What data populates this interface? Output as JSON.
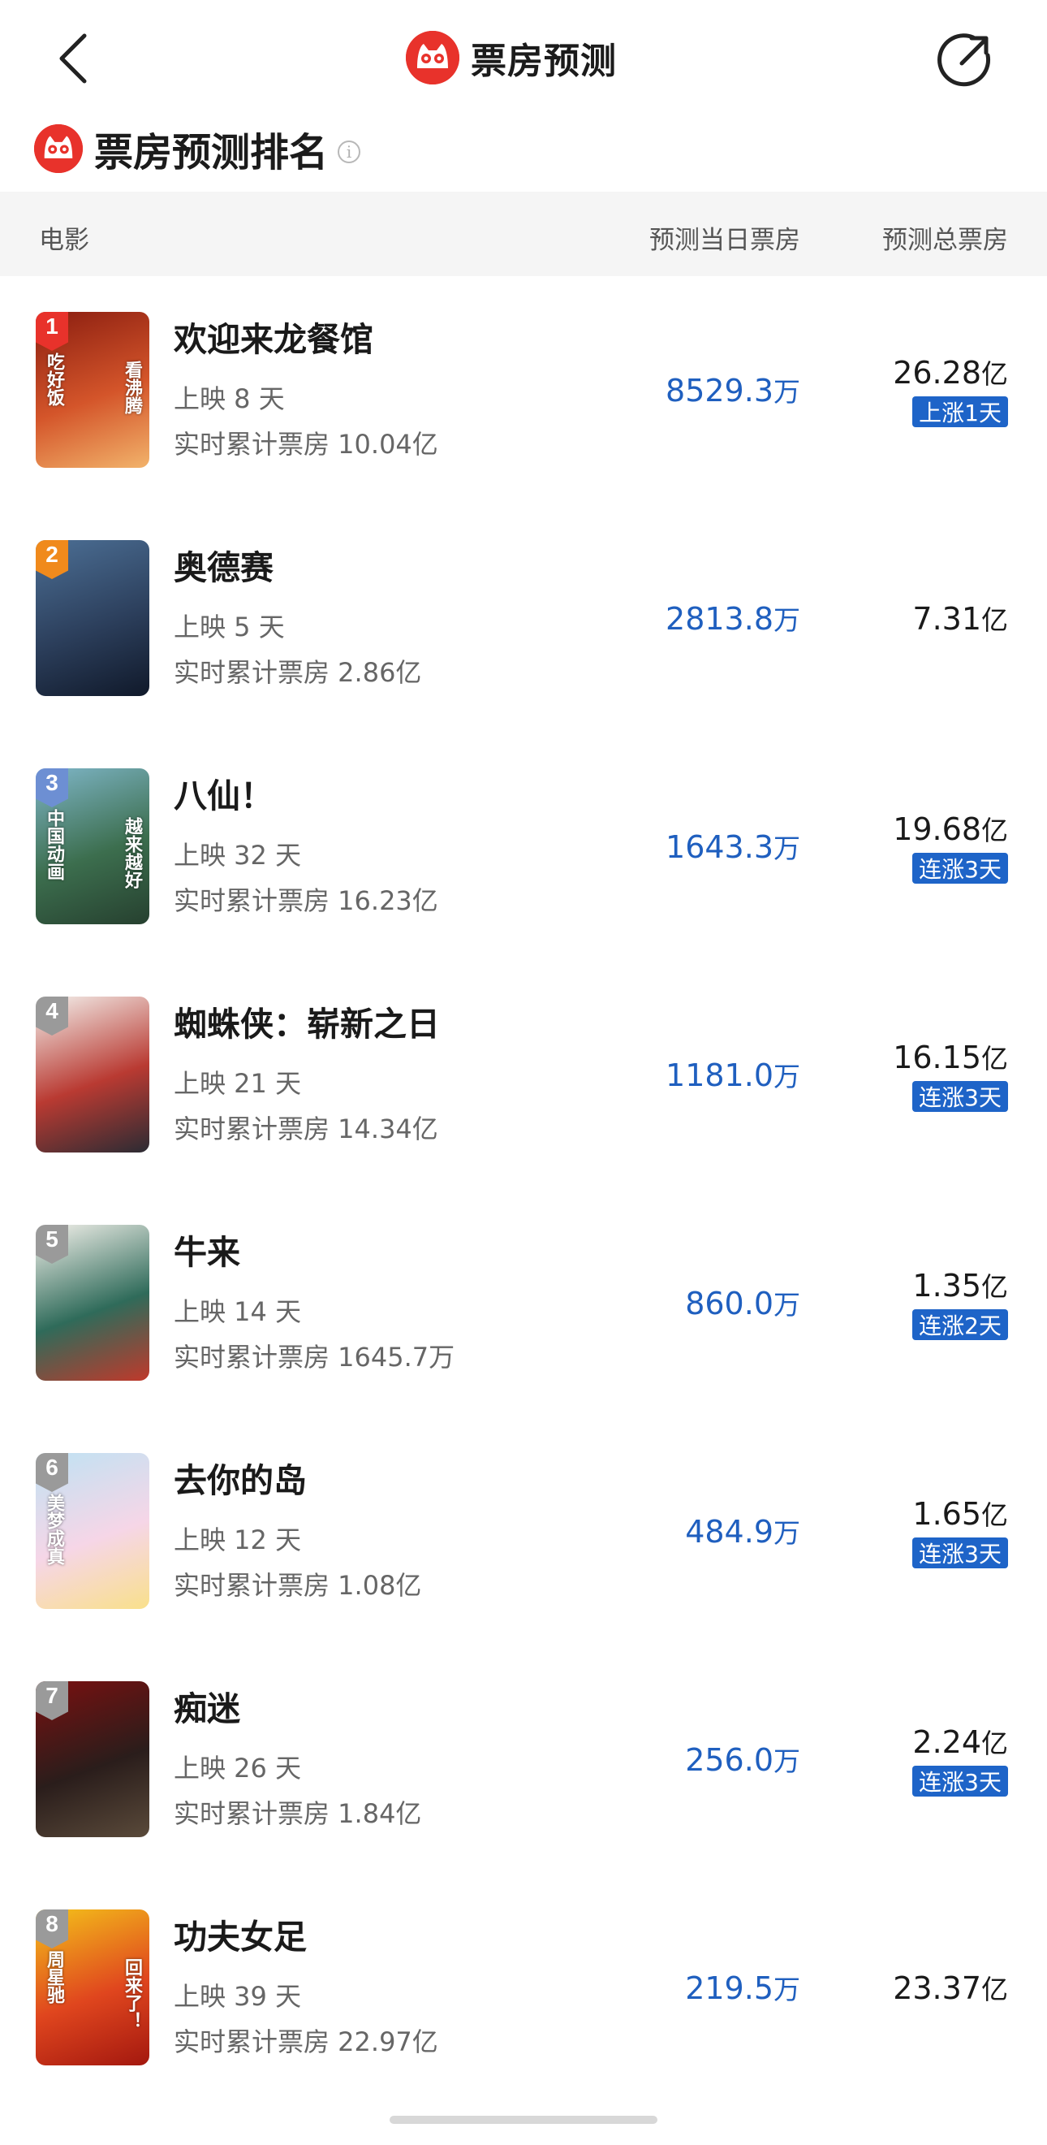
{
  "header": {
    "title": "票房预测",
    "brand_color": "#e8322b"
  },
  "section": {
    "title": "票房预测排名",
    "info_icon": "info-icon"
  },
  "table": {
    "col_movie": "电影",
    "col_daily": "预测当日票房",
    "col_total": "预测总票房"
  },
  "accent_color": "#1e64c8",
  "movies": [
    {
      "rank": "1",
      "name": "欢迎来龙餐馆",
      "days": "上映 8 天",
      "cumulative": "实时累计票房 10.04亿",
      "daily_value": "8529.3",
      "daily_unit": "万",
      "total_value": "26.28",
      "total_unit": "亿",
      "trend": "上涨1天"
    },
    {
      "rank": "2",
      "name": "奥德赛",
      "days": "上映 5 天",
      "cumulative": "实时累计票房 2.86亿",
      "daily_value": "2813.8",
      "daily_unit": "万",
      "total_value": "7.31",
      "total_unit": "亿",
      "trend": ""
    },
    {
      "rank": "3",
      "name": "八仙！",
      "days": "上映 32 天",
      "cumulative": "实时累计票房 16.23亿",
      "daily_value": "1643.3",
      "daily_unit": "万",
      "total_value": "19.68",
      "total_unit": "亿",
      "trend": "连涨3天"
    },
    {
      "rank": "4",
      "name": "蜘蛛侠：崭新之日",
      "days": "上映 21 天",
      "cumulative": "实时累计票房 14.34亿",
      "daily_value": "1181.0",
      "daily_unit": "万",
      "total_value": "16.15",
      "total_unit": "亿",
      "trend": "连涨3天"
    },
    {
      "rank": "5",
      "name": "牛来",
      "days": "上映 14 天",
      "cumulative": "实时累计票房 1645.7万",
      "daily_value": "860.0",
      "daily_unit": "万",
      "total_value": "1.35",
      "total_unit": "亿",
      "trend": "连涨2天"
    },
    {
      "rank": "6",
      "name": "去你的岛",
      "days": "上映 12 天",
      "cumulative": "实时累计票房 1.08亿",
      "daily_value": "484.9",
      "daily_unit": "万",
      "total_value": "1.65",
      "total_unit": "亿",
      "trend": "连涨3天"
    },
    {
      "rank": "7",
      "name": "痴迷",
      "days": "上映 26 天",
      "cumulative": "实时累计票房 1.84亿",
      "daily_value": "256.0",
      "daily_unit": "万",
      "total_value": "2.24",
      "total_unit": "亿",
      "trend": "连涨3天"
    },
    {
      "rank": "8",
      "name": "功夫女足",
      "days": "上映 39 天",
      "cumulative": "实时累计票房 22.97亿",
      "daily_value": "219.5",
      "daily_unit": "万",
      "total_value": "23.37",
      "total_unit": "亿",
      "trend": ""
    }
  ],
  "posters": [
    {
      "text_a": "吃好饭",
      "text_b": "看沸腾",
      "badge_color": "#e8322b",
      "colors": [
        "#8a1d10",
        "#d4552a",
        "#f2b36b"
      ]
    },
    {
      "text_a": "",
      "text_b": "",
      "badge_color": "#f08a1c",
      "colors": [
        "#4c6f95",
        "#2c3f5c",
        "#10192a"
      ]
    },
    {
      "text_a": "中国动画",
      "text_b": "越来越好",
      "badge_color": "#6d8fd3",
      "colors": [
        "#7fb6c8",
        "#3c6e4e",
        "#26402f"
      ]
    },
    {
      "text_a": "",
      "text_b": "",
      "badge_color": "#9a9a9a",
      "colors": [
        "#f4f2ee",
        "#b93a32",
        "#2b2b33"
      ]
    },
    {
      "text_a": "",
      "text_b": "",
      "badge_color": "#9a9a9a",
      "colors": [
        "#f5f2ec",
        "#2f6b5a",
        "#c0392b"
      ]
    },
    {
      "text_a": "美梦成真",
      "text_b": "",
      "badge_color": "#9a9a9a",
      "colors": [
        "#bfe2f3",
        "#f6d6e7",
        "#f9e08b"
      ]
    },
    {
      "text_a": "",
      "text_b": "",
      "badge_color": "#9a9a9a",
      "colors": [
        "#7a1010",
        "#2a1d1b",
        "#5a4a3a"
      ]
    },
    {
      "text_a": "周星驰",
      "text_b": "回来了！",
      "badge_color": "#9a9a9a",
      "colors": [
        "#f4c21a",
        "#e0461e",
        "#a3180f"
      ]
    }
  ]
}
